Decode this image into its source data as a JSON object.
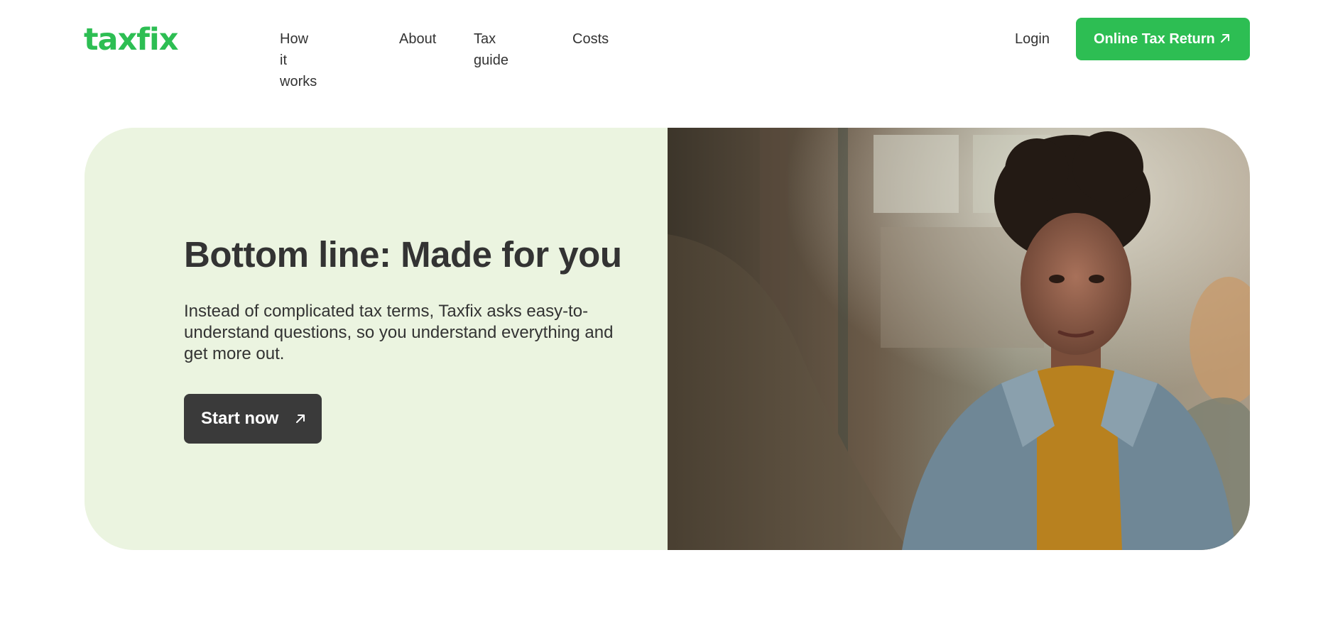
{
  "header": {
    "logo": "taxfix",
    "nav": [
      "How it works",
      "About",
      "Tax guide",
      "Costs"
    ],
    "login": "Login",
    "cta_label": "Online Tax Return"
  },
  "hero": {
    "title": "Bottom line: Made for you",
    "text": "Instead of complicated tax terms, Taxfix asks easy-to-understand questions, so you understand everything and get more out.",
    "button_label": "Start now",
    "photo": "woman-in-denim-jacket-photo"
  },
  "colors": {
    "brand_green": "#2dbe53",
    "hero_background": "#ebf4e0",
    "dark_button": "#3a3a3a",
    "text": "#333333"
  },
  "icons": {
    "cta_arrow": "arrow-up-right-icon",
    "start_arrow": "arrow-up-right-icon"
  }
}
